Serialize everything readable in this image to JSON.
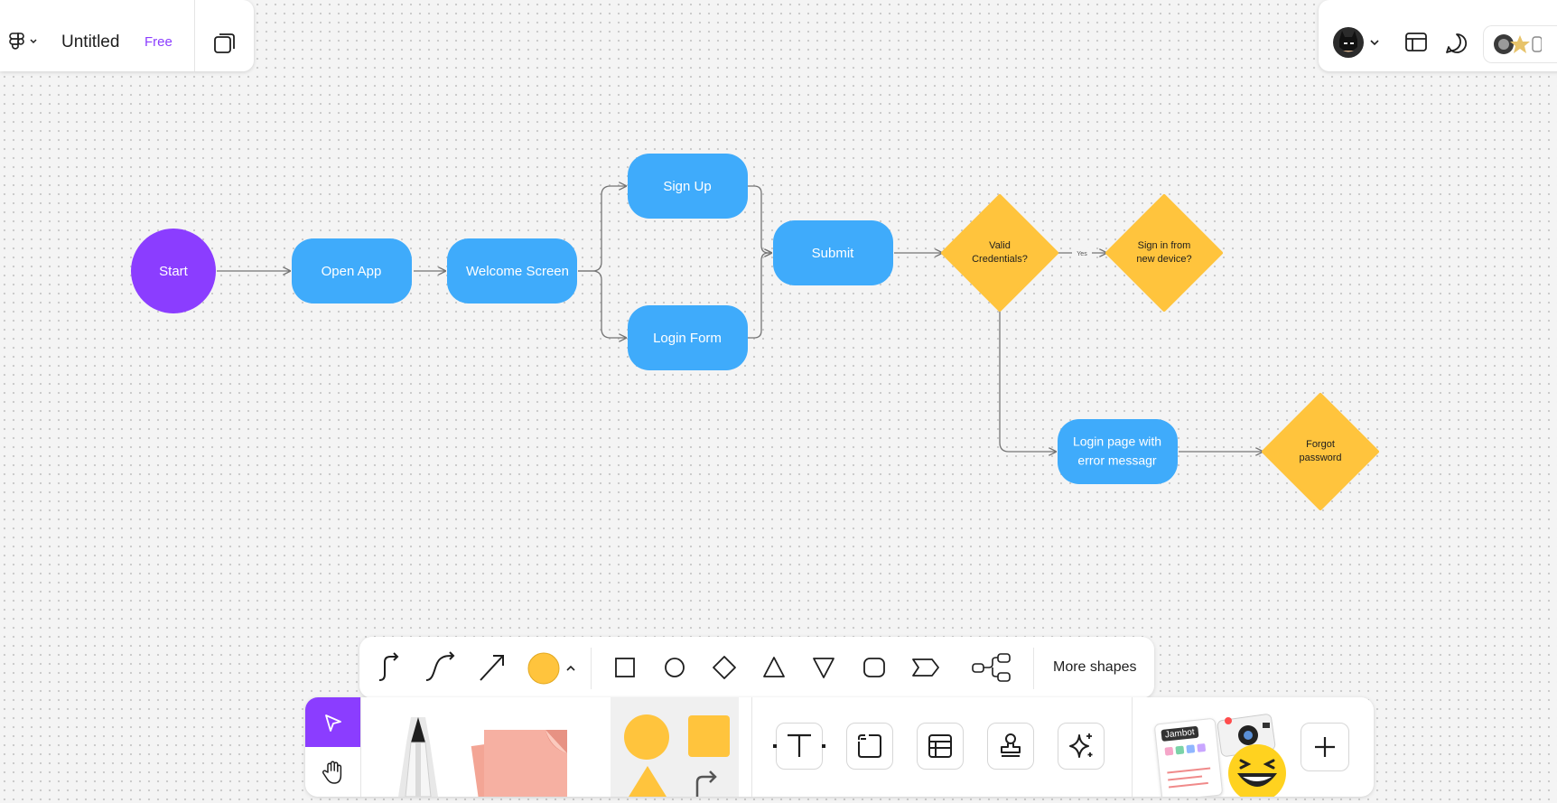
{
  "file": {
    "title": "Untitled",
    "plan_badge": "Free"
  },
  "colors": {
    "accent": "#8b3dff",
    "blue_node": "#3fabfb",
    "start_node": "#8b3dff",
    "decision": "#ffc43d",
    "connector": "#757575"
  },
  "diagram": {
    "nodes": {
      "start": "Start",
      "open_app": "Open App",
      "welcome": "Welcome Screen",
      "sign_up": "Sign Up",
      "login_form": "Login Form",
      "submit": "Submit",
      "valid_credentials_l1": "Valid",
      "valid_credentials_l2": "Credentials?",
      "new_device_l1": "Sign in from",
      "new_device_l2": "new device?",
      "error_page_l1": "Login page with",
      "error_page_l2": "error messagr",
      "forgot_l1": "Forgot",
      "forgot_l2": "password"
    },
    "edge_labels": {
      "yes": "Yes"
    }
  },
  "shape_toolbar": {
    "tools": [
      "elbow-connector-icon",
      "curved-connector-icon",
      "straight-arrow-icon",
      "color-swatch",
      "square-icon",
      "circle-icon",
      "diamond-icon",
      "triangle-icon",
      "inverted-triangle-icon",
      "rounded-rect-icon",
      "chevron-tag-icon",
      "mindmap-icon"
    ],
    "selected_color": "#ffc43d",
    "more_label": "More shapes"
  },
  "main_toolbar": {
    "tools": [
      "select-icon",
      "hand-icon",
      "pencil-tool",
      "sticky-note-tool",
      "shapes-tool",
      "text-icon",
      "section-icon",
      "table-icon",
      "stamp-icon",
      "ai-sparkle-icon",
      "widgets-tool",
      "add-icon"
    ],
    "widget_label": "Jambot"
  }
}
